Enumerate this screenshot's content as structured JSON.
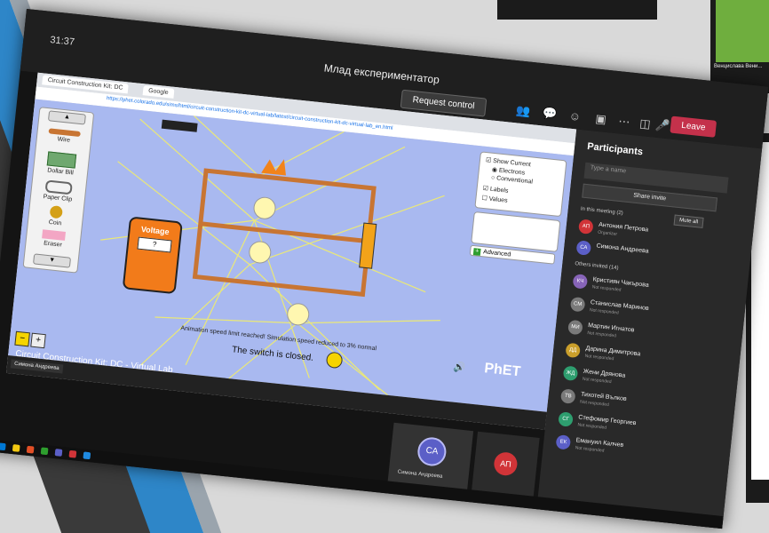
{
  "teams": {
    "clock": "31:37",
    "meeting_title": "Млад експериментатор",
    "request_control": "Request control",
    "leave": "Leave"
  },
  "browser": {
    "tabs": [
      "Circuit Construction Kit: DC",
      "Google"
    ],
    "url": "https://phet.colorado.edu/sims/html/circuit-construction-kit-dc-virtual-lab/latest/circuit-construction-kit-dc-virtual-lab_en.html"
  },
  "sim": {
    "tools": [
      "Wire",
      "Dollar Bill",
      "Paper Clip",
      "Coin",
      "Eraser"
    ],
    "voltmeter_label": "Voltage",
    "voltmeter_value": "?",
    "controls": {
      "show_current": "Show Current",
      "electrons": "Electrons",
      "conventional": "Conventional",
      "labels": "Labels",
      "values": "Values"
    },
    "advanced": "Advanced",
    "speed_message": "Animation speed limit reached! Simulation speed reduced to 3% normal",
    "switch_status": "The switch is closed.",
    "title": "Circuit Construction Kit: DC - Virtual Lab",
    "phet": "PhET"
  },
  "participants": {
    "title": "Participants",
    "search_placeholder": "Type a name",
    "share_invite": "Share invite",
    "in_meeting": "In this meeting (2)",
    "mute_all": "Mute all",
    "others_invited": "Others invited (14)",
    "in_meeting_people": [
      {
        "initials": "АП",
        "name": "Антония Петрова",
        "status": "Organizer",
        "color": "#d13438"
      },
      {
        "initials": "СА",
        "name": "Симона Андреева",
        "status": "",
        "color": "#5b5fc7"
      }
    ],
    "invited_people": [
      {
        "initials": "КЧ",
        "name": "Кристиян Чакърова",
        "status": "Not responded",
        "color": "#8764b8"
      },
      {
        "initials": "СМ",
        "name": "Станислав Маринов",
        "status": "Not responded",
        "color": "#7a7a7a"
      },
      {
        "initials": "МИ",
        "name": "Мартин Игнатов",
        "status": "Not responded",
        "color": "#7a7a7a"
      },
      {
        "initials": "ДД",
        "name": "Дарина Димитрова",
        "status": "Not responded",
        "color": "#ca9f2b"
      },
      {
        "initials": "ЖД",
        "name": "Жени Дрянова",
        "status": "Not responded",
        "color": "#2e9e6f"
      },
      {
        "initials": "ТВ",
        "name": "Тихотей Вълков",
        "status": "Not responded",
        "color": "#7a7a7a"
      },
      {
        "initials": "СГ",
        "name": "Стефомир Георгиев",
        "status": "Not responded",
        "color": "#2e9e6f"
      },
      {
        "initials": "ЕК",
        "name": "Емануил Калчев",
        "status": "Not responded",
        "color": "#5b5fc7"
      }
    ]
  },
  "video": {
    "self_initials": "СА",
    "self_name": "Симона Андреева",
    "other_initials": "АП"
  },
  "side_screens": {
    "right_caption": "Cir",
    "top_right_label": "Венцислава Вени..."
  }
}
